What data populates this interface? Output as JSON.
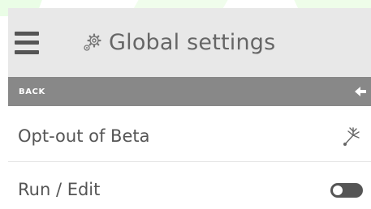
{
  "header": {
    "title": "Global settings",
    "menu_icon": "hamburger-menu-icon",
    "title_icon": "gears-icon"
  },
  "backbar": {
    "label": "BACK",
    "icon": "arrow-left-icon"
  },
  "settings": [
    {
      "label": "Opt-out of Beta",
      "icon": "beta-tree-icon"
    },
    {
      "label": "Run / Edit",
      "control": "toggle",
      "state": "off"
    }
  ],
  "colors": {
    "header_bg": "#e8e8e8",
    "backbar_bg": "#888888",
    "toggle_bg": "#555555",
    "accent_green": "#eafde6"
  }
}
